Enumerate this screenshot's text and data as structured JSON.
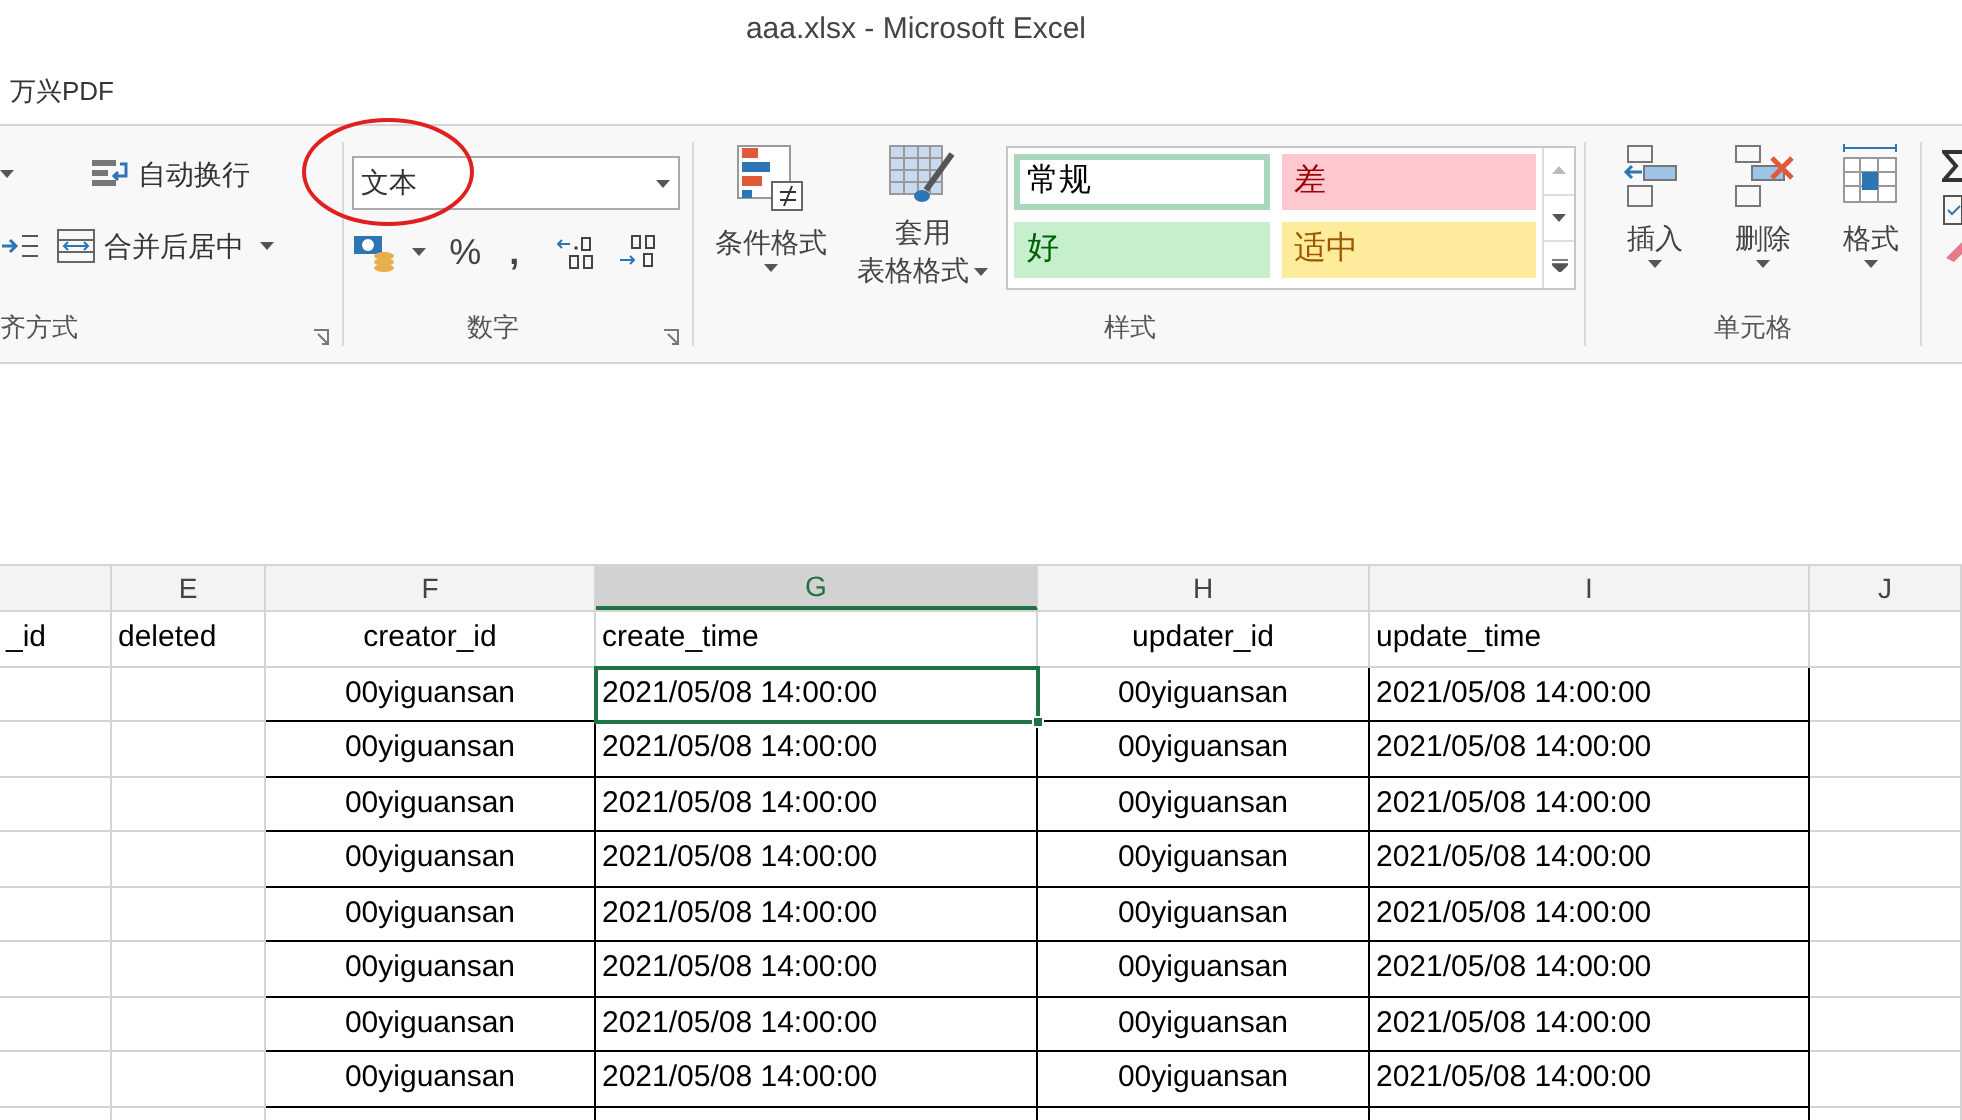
{
  "window": {
    "title": "aaa.xlsx - Microsoft Excel"
  },
  "menu": [
    "万兴PDF"
  ],
  "ribbon": {
    "alignment": {
      "wrap_text": "自动换行",
      "merge_center": "合并后居中",
      "label": "齐方式"
    },
    "number": {
      "format": "文本",
      "percent": "%",
      "comma": ",",
      "label": "数字"
    },
    "styles": {
      "conditional": "条件格式",
      "table_format": [
        "套用",
        "表格格式"
      ],
      "label": "样式",
      "gallery": [
        {
          "text": "常规",
          "kind": "normal",
          "selected": true
        },
        {
          "text": "差",
          "kind": "bad",
          "selected": false
        },
        {
          "text": "好",
          "kind": "good",
          "selected": false
        },
        {
          "text": "适中",
          "kind": "neutral",
          "selected": false
        }
      ]
    },
    "cells": {
      "buttons": [
        "插入",
        "删除",
        "格式"
      ],
      "label": "单元格"
    }
  },
  "sheet": {
    "columns": [
      {
        "selected": false
      },
      {
        "letter": "E",
        "selected": false
      },
      {
        "letter": "F",
        "selected": false
      },
      {
        "letter": "G",
        "selected": true
      },
      {
        "letter": "H",
        "selected": false
      },
      {
        "letter": "I",
        "selected": false
      },
      {
        "letter": "J",
        "selected": false
      }
    ],
    "rows": [
      {
        "bordered": false,
        "cells": [
          {
            "text": "_id",
            "selected": false
          },
          {
            "text": "deleted",
            "selected": false
          },
          {
            "text": "creator_id",
            "selected": false
          },
          {
            "text": "create_time",
            "selected": false
          },
          {
            "text": "updater_id",
            "selected": false
          },
          {
            "text": "update_time",
            "selected": false
          },
          {
            "selected": false
          }
        ]
      },
      {
        "bordered": true,
        "cells": [
          {
            "selected": false
          },
          {
            "selected": false
          },
          {
            "text": "00yiguansan",
            "selected": false
          },
          {
            "text": "2021/05/08 14:00:00",
            "selected": true
          },
          {
            "text": "00yiguansan",
            "selected": false
          },
          {
            "text": "2021/05/08 14:00:00",
            "selected": false
          },
          {
            "selected": false
          }
        ]
      },
      {
        "bordered": true,
        "cells": [
          {
            "selected": false
          },
          {
            "selected": false
          },
          {
            "text": "00yiguansan",
            "selected": false
          },
          {
            "text": "2021/05/08 14:00:00",
            "selected": false
          },
          {
            "text": "00yiguansan",
            "selected": false
          },
          {
            "text": "2021/05/08 14:00:00",
            "selected": false
          },
          {
            "selected": false
          }
        ]
      },
      {
        "bordered": true,
        "cells": [
          {
            "selected": false
          },
          {
            "selected": false
          },
          {
            "text": "00yiguansan",
            "selected": false
          },
          {
            "text": "2021/05/08 14:00:00",
            "selected": false
          },
          {
            "text": "00yiguansan",
            "selected": false
          },
          {
            "text": "2021/05/08 14:00:00",
            "selected": false
          },
          {
            "selected": false
          }
        ]
      },
      {
        "bordered": true,
        "cells": [
          {
            "selected": false
          },
          {
            "selected": false
          },
          {
            "text": "00yiguansan",
            "selected": false
          },
          {
            "text": "2021/05/08 14:00:00",
            "selected": false
          },
          {
            "text": "00yiguansan",
            "selected": false
          },
          {
            "text": "2021/05/08 14:00:00",
            "selected": false
          },
          {
            "selected": false
          }
        ]
      },
      {
        "bordered": true,
        "cells": [
          {
            "selected": false
          },
          {
            "selected": false
          },
          {
            "text": "00yiguansan",
            "selected": false
          },
          {
            "text": "2021/05/08 14:00:00",
            "selected": false
          },
          {
            "text": "00yiguansan",
            "selected": false
          },
          {
            "text": "2021/05/08 14:00:00",
            "selected": false
          },
          {
            "selected": false
          }
        ]
      },
      {
        "bordered": true,
        "cells": [
          {
            "selected": false
          },
          {
            "selected": false
          },
          {
            "text": "00yiguansan",
            "selected": false
          },
          {
            "text": "2021/05/08 14:00:00",
            "selected": false
          },
          {
            "text": "00yiguansan",
            "selected": false
          },
          {
            "text": "2021/05/08 14:00:00",
            "selected": false
          },
          {
            "selected": false
          }
        ]
      },
      {
        "bordered": true,
        "cells": [
          {
            "selected": false
          },
          {
            "selected": false
          },
          {
            "text": "00yiguansan",
            "selected": false
          },
          {
            "text": "2021/05/08 14:00:00",
            "selected": false
          },
          {
            "text": "00yiguansan",
            "selected": false
          },
          {
            "text": "2021/05/08 14:00:00",
            "selected": false
          },
          {
            "selected": false
          }
        ]
      },
      {
        "bordered": true,
        "cells": [
          {
            "selected": false
          },
          {
            "selected": false
          },
          {
            "text": "00yiguansan",
            "selected": false
          },
          {
            "text": "2021/05/08 14:00:00",
            "selected": false
          },
          {
            "text": "00yiguansan",
            "selected": false
          },
          {
            "text": "2021/05/08 14:00:00",
            "selected": false
          },
          {
            "selected": false
          }
        ]
      },
      {
        "bordered": true,
        "cells": [
          {
            "selected": false
          },
          {
            "selected": false
          },
          {
            "selected": false
          },
          {
            "selected": false
          },
          {
            "selected": false
          },
          {
            "selected": false
          },
          {
            "selected": false
          }
        ]
      }
    ]
  }
}
